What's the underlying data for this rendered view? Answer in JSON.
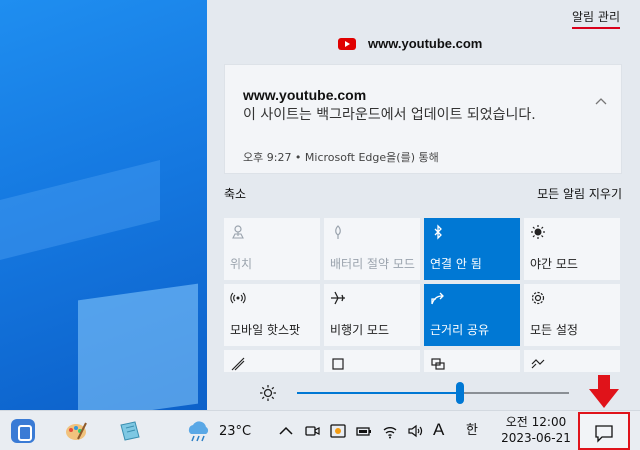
{
  "action_center": {
    "manage_label": "알림 관리",
    "app_name": "www.youtube.com",
    "notification": {
      "title": "www.youtube.com",
      "body": "이 사이트는 백그라운드에서 업데이트 되었습니다.",
      "meta": "오후 9:27 • Microsoft Edge을(를) 통해"
    },
    "collapse_label": "축소",
    "clear_all_label": "모든 알림 지우기",
    "tiles": [
      {
        "label": "위치",
        "icon": "location-icon",
        "state": "off"
      },
      {
        "label": "배터리 절약 모드",
        "icon": "battery-saver-icon",
        "state": "off"
      },
      {
        "label": "연결 안 됨",
        "icon": "bluetooth-icon",
        "state": "on"
      },
      {
        "label": "야간 모드",
        "icon": "night-light-icon",
        "state": "normal"
      },
      {
        "label": "모바일 핫스팟",
        "icon": "hotspot-icon",
        "state": "normal"
      },
      {
        "label": "비행기 모드",
        "icon": "airplane-icon",
        "state": "normal"
      },
      {
        "label": "근거리 공유",
        "icon": "nearby-share-icon",
        "state": "on"
      },
      {
        "label": "모든 설정",
        "icon": "gear-icon",
        "state": "normal"
      }
    ],
    "brightness": 0.6
  },
  "taskbar": {
    "temperature": "23°C",
    "input_lang": "A",
    "ime": "한",
    "time": "오전 12:00",
    "date": "2023-06-21"
  },
  "colors": {
    "accent": "#0078d4",
    "highlight": "#e0131a",
    "youtube": "#e00000"
  }
}
